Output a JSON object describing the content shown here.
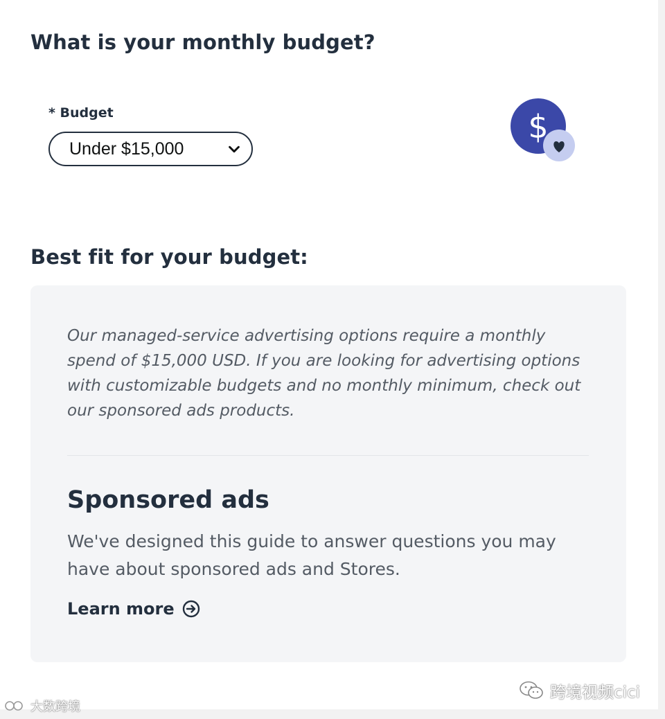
{
  "budget_question": {
    "heading": "What is your monthly budget?",
    "field_label": "* Budget",
    "selected_value": "Under $15,000"
  },
  "best_fit": {
    "heading": "Best fit for your budget:",
    "notice": "Our managed-service advertising options require a monthly spend of $15,000 USD. If you are looking for advertising options with customizable budgets and no monthly minimum, check out our sponsored ads products.",
    "product": {
      "title": "Sponsored ads",
      "description": "We've designed this guide to answer questions you may have about sponsored ads and Stores.",
      "link_label": "Learn more"
    }
  },
  "watermarks": {
    "right": "跨境视频cici",
    "left": "大数跨境"
  },
  "icons": {
    "budget_badge": "dollar-heart-icon",
    "dropdown": "chevron-down-icon",
    "link_arrow": "circle-arrow-right-icon",
    "wechat": "wechat-icon"
  },
  "colors": {
    "text_primary": "#232f3e",
    "text_secondary": "#545b64",
    "card_background": "#f4f5f7",
    "badge_primary": "#3b48a8",
    "badge_secondary": "#c5cdf0"
  }
}
